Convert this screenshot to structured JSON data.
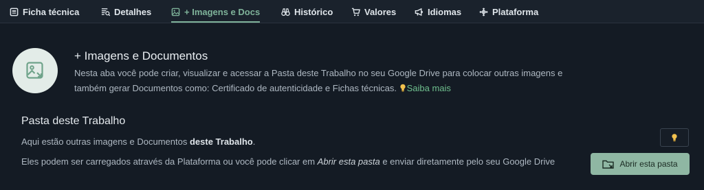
{
  "tabs": [
    {
      "label": "Ficha técnica",
      "icon": "document-icon"
    },
    {
      "label": "Detalhes",
      "icon": "details-list-icon"
    },
    {
      "label": "+ Imagens e Docs",
      "icon": "image-icon",
      "active": true
    },
    {
      "label": "Histórico",
      "icon": "binoculars-icon"
    },
    {
      "label": "Valores",
      "icon": "cart-icon"
    },
    {
      "label": "Idiomas",
      "icon": "megaphone-icon"
    },
    {
      "label": "Plataforma",
      "icon": "platform-icon"
    }
  ],
  "hero": {
    "icon": "image-link-icon",
    "title": "+ Imagens e Documentos",
    "description": "Nesta aba você pode criar, visualizar e acessar a Pasta deste Trabalho no seu Google Drive para colocar outras imagens e também gerar Documentos como: Certificado de autenticidade e Fichas técnicas.",
    "link_icon": "lightbulb-icon",
    "link_label": "Saiba mais"
  },
  "section": {
    "title": "Pasta deste Trabalho",
    "p1_prefix": "Aqui estão outras imagens e Documentos ",
    "p1_bold": "deste Trabalho",
    "p1_suffix": ".",
    "p2_prefix": "Eles podem ser carregados através da Plataforma ou você pode clicar em ",
    "p2_italic": "Abrir esta pasta",
    "p2_suffix": " e enviar diretamente pelo seu Google Drive"
  },
  "hint_button": {
    "icon": "lightbulb-icon"
  },
  "open_button": {
    "icon": "folder-link-icon",
    "label": "Abrir esta pasta"
  },
  "colors": {
    "accent": "#7fb39a",
    "link": "#6fbf8e",
    "button_bg": "#8fb7a3",
    "bulb": "#f2c14e",
    "background": "#141b24"
  }
}
